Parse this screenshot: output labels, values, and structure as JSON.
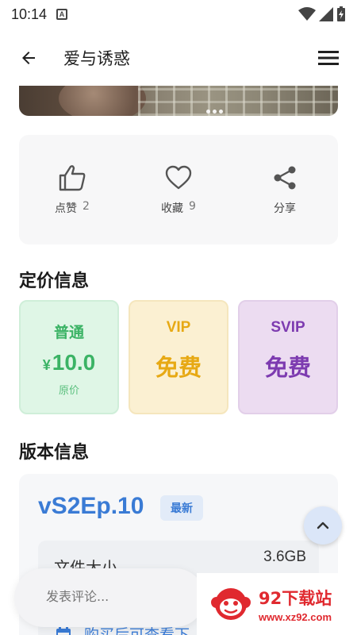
{
  "status_bar": {
    "time": "10:14",
    "notification_badge": "A"
  },
  "app_bar": {
    "title": "爱与诱惑"
  },
  "actions": [
    {
      "label": "点赞",
      "count": "2",
      "icon": "thumbs-up-icon"
    },
    {
      "label": "收藏",
      "count": "9",
      "icon": "heart-icon"
    },
    {
      "label": "分享",
      "count": "",
      "icon": "share-icon"
    }
  ],
  "pricing": {
    "title": "定价信息",
    "tiers": [
      {
        "name": "普通",
        "currency": "¥",
        "value": "10.0",
        "sub": "原价",
        "color": "#3bb365"
      },
      {
        "name": "VIP",
        "value": "免费",
        "color": "#e7a914"
      },
      {
        "name": "SVIP",
        "value": "免费",
        "color": "#7d3bb0"
      }
    ]
  },
  "version": {
    "title": "版本信息",
    "name": "vS2Ep.10",
    "badge": "最新",
    "file_size_label": "文件大小",
    "file_size_value": "3.6GB",
    "purchase_text": "购买后可查看下"
  },
  "comment": {
    "placeholder": "发表评论..."
  },
  "watermark": {
    "title": "92下载站",
    "url": "www.xz92.com"
  },
  "colors": {
    "accent": "#3a7bd5",
    "normal": "#3bb365",
    "vip": "#e7a914",
    "svip": "#7d3bb0"
  }
}
